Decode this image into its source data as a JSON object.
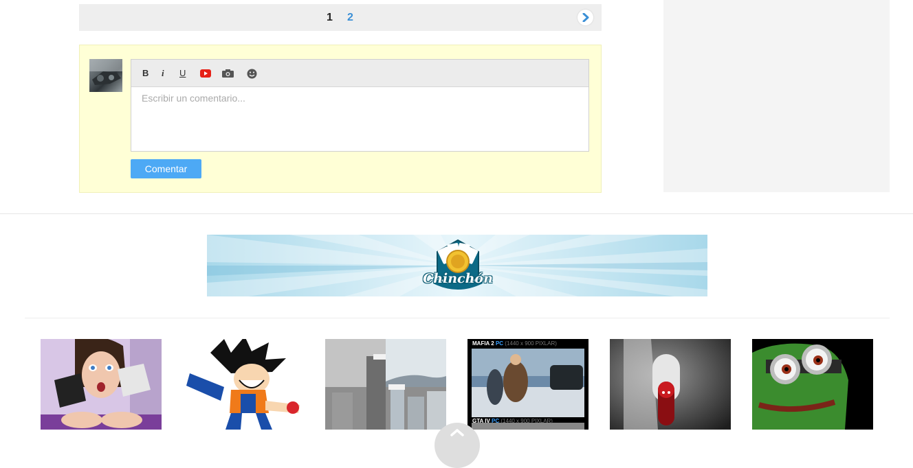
{
  "pagination": {
    "current_page": "1",
    "next_page": "2",
    "next_icon": "chevron-right-icon"
  },
  "comment_form": {
    "toolbar": {
      "bold_label": "B",
      "italic_label": "i",
      "underline_label": "U",
      "youtube_icon": "youtube-icon",
      "camera_icon": "camera-icon",
      "emoji_icon": "smiley-icon"
    },
    "placeholder": "Escribir un comentario...",
    "value": "",
    "submit_label": "Comentar"
  },
  "banner": {
    "logo_text": "Chinchón"
  },
  "thumbnails": [
    {
      "subject": "woman-with-gamepads"
    },
    {
      "subject": "goku-cartoon"
    },
    {
      "subject": "city-skyline"
    },
    {
      "subject": "mafia-gta-comparison",
      "top_label": {
        "game": "MAFIA 2",
        "platform": "PC",
        "res": "(1440 x 900 PIXLAR)"
      },
      "bottom_label": {
        "game": "GTA IV",
        "platform": "PC",
        "res": "(1440 x 900 PIXLAR)"
      }
    },
    {
      "subject": "pill-in-hand"
    },
    {
      "subject": "pepe-frog-minion"
    }
  ],
  "colors": {
    "link_blue": "#3a8fd6",
    "button_blue": "#4da9f5",
    "comment_bg": "#ffffd6",
    "youtube_red": "#e62117"
  }
}
